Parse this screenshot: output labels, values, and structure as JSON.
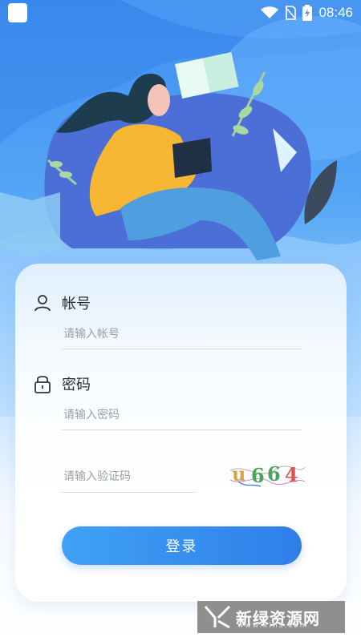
{
  "status_bar": {
    "time": "08:46",
    "icons": [
      "app-square-icon",
      "wifi-icon",
      "no-sim-icon",
      "battery-charging-icon"
    ]
  },
  "login": {
    "account_label": "帐号",
    "account_placeholder": "请输入帐号",
    "password_label": "密码",
    "password_placeholder": "请输入密码",
    "captcha_placeholder": "请输入验证码",
    "captcha_text": "u664",
    "submit_label": "登录"
  },
  "watermark": {
    "text": "新绿资源网",
    "sub": "www.xlhs.com"
  },
  "colors": {
    "primary": "#2f7ee8",
    "accent": "#3fa2f6",
    "background_top": "#3f8ef2"
  }
}
